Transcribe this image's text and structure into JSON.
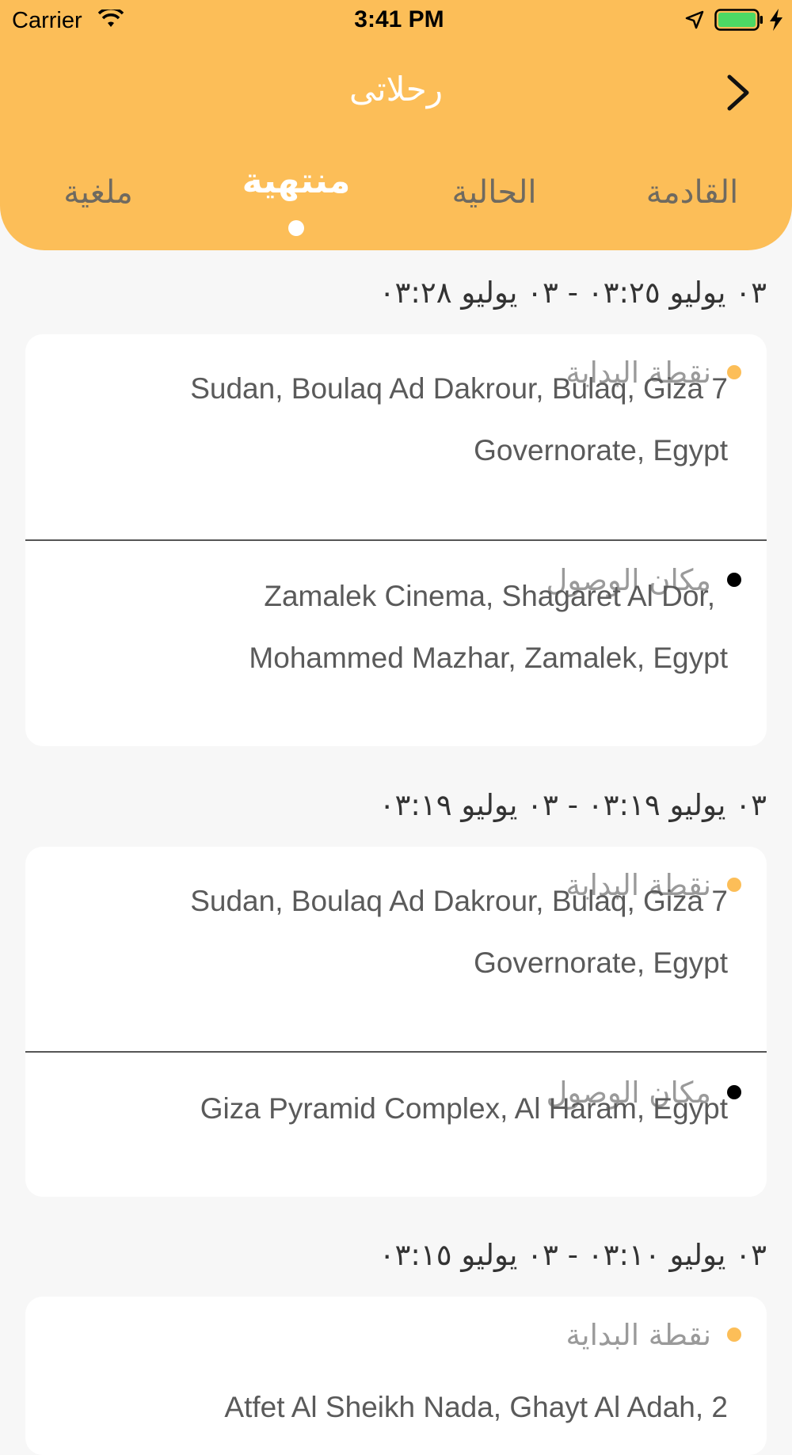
{
  "status_bar": {
    "carrier": "Carrier",
    "time": "3:41 PM"
  },
  "header": {
    "title": "رحلاتى"
  },
  "tabs": [
    {
      "label": "القادمة",
      "active": false
    },
    {
      "label": "الحالية",
      "active": false
    },
    {
      "label": "منتهية",
      "active": true
    },
    {
      "label": "ملغية",
      "active": false
    }
  ],
  "trips": [
    {
      "date_range": "٠٣ يوليو ٠٣:٢٥ - ٠٣ يوليو ٠٣:٢٨",
      "start_label": "نقطة البداية",
      "start_address_lines": [
        "Sudan, Boulaq Ad Dakrour, Bulaq, Giza 7",
        "Governorate, Egypt"
      ],
      "end_label": "مكان الوصول",
      "end_address_lines": [
        "Zamalek Cinema, Shagaret Al Dor,",
        "Mohammed Mazhar, Zamalek, Egypt"
      ]
    },
    {
      "date_range": "٠٣ يوليو ٠٣:١٩ - ٠٣ يوليو ٠٣:١٩",
      "start_label": "نقطة البداية",
      "start_address_lines": [
        "Sudan, Boulaq Ad Dakrour, Bulaq, Giza 7",
        "Governorate, Egypt"
      ],
      "end_label": "مكان الوصول",
      "end_address_lines": [
        "Giza Pyramid Complex, Al Haram, Egypt"
      ]
    },
    {
      "date_range": "٠٣ يوليو ٠٣:١٠ - ٠٣ يوليو ٠٣:١٥",
      "start_label": "نقطة البداية",
      "start_address_lines": [
        "Atfet Al Sheikh Nada, Ghayt Al Adah, 2"
      ]
    }
  ],
  "colors": {
    "accent": "#fcbe58",
    "background": "#f7f7f7",
    "card": "#ffffff"
  }
}
